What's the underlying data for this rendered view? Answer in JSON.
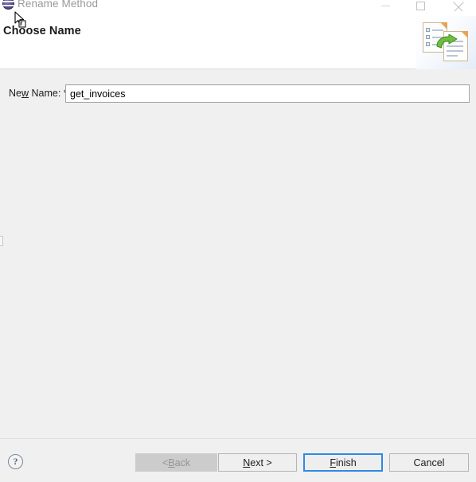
{
  "window": {
    "title": "Rename Method",
    "app_icon": "eclipse-oval-icon",
    "controls": {
      "minimize": "minimize-icon",
      "maximize": "maximize-icon",
      "close": "close-icon"
    }
  },
  "header": {
    "title": "Choose Name",
    "banner_icon": "refactor-rename-icon"
  },
  "form": {
    "new_name": {
      "label_prefix": "Ne",
      "label_mnemonic": "w",
      "label_suffix": " Name: *",
      "value": "get_invoices",
      "placeholder": ""
    }
  },
  "footer": {
    "help_glyph": "?",
    "buttons": {
      "back": {
        "prefix": "< ",
        "mnemonic": "B",
        "suffix": "ack",
        "enabled": false
      },
      "next": {
        "prefix": "",
        "mnemonic": "N",
        "suffix": "ext >",
        "enabled": true
      },
      "finish": {
        "prefix": "",
        "mnemonic": "F",
        "suffix": "inish",
        "enabled": true,
        "focused": true
      },
      "cancel": {
        "prefix": "",
        "mnemonic": "",
        "suffix": "Cancel",
        "enabled": true
      }
    }
  },
  "colors": {
    "dialog_bg": "#f0f0f0",
    "header_bg": "#ffffff",
    "focus_border": "#2e8ae6",
    "disabled_bg": "#cccccc",
    "disabled_text": "#949494",
    "title_text": "#9a9a9a",
    "accent_green": "#5fa832",
    "accent_orange": "#e8a355"
  }
}
